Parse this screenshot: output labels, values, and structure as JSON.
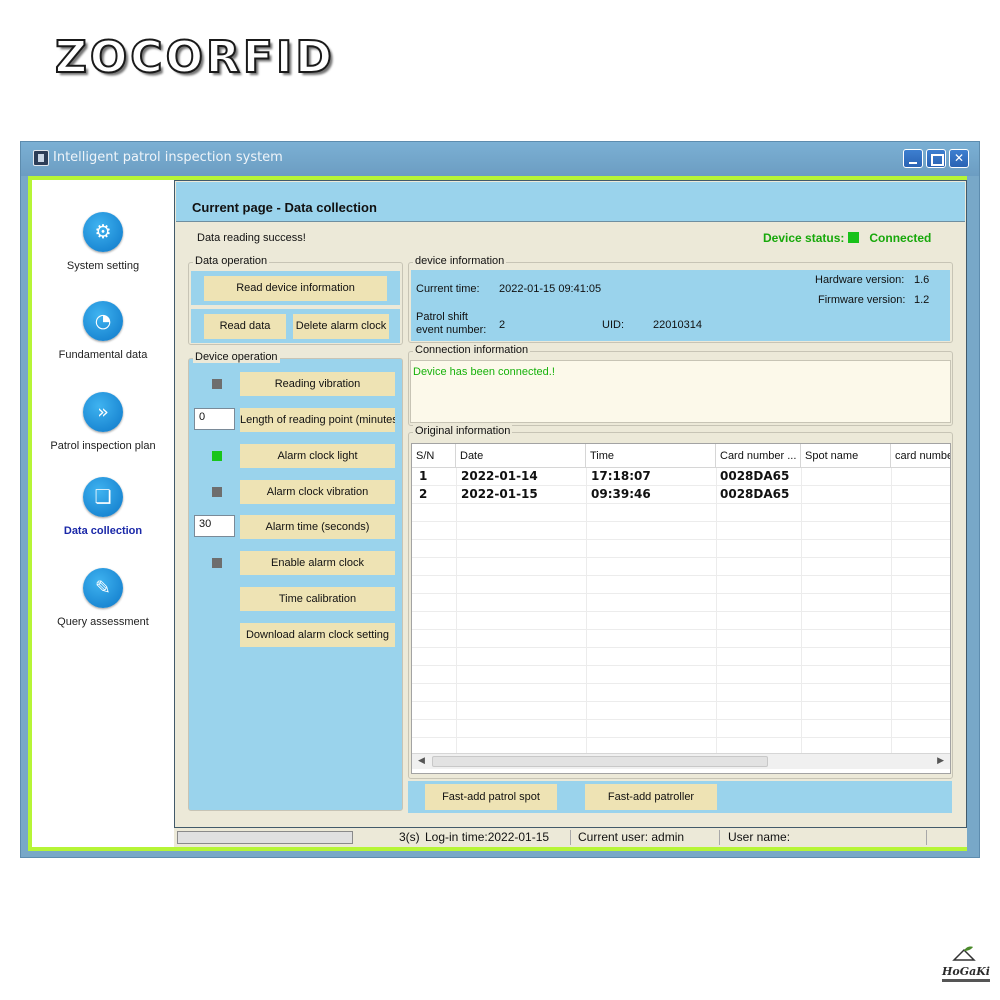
{
  "brand": {
    "logo_text": "ZOCORFID"
  },
  "window": {
    "title": "Intelligent patrol inspection system"
  },
  "sidebar": {
    "items": [
      {
        "label": "System setting",
        "icon": "gear-icon",
        "active": false
      },
      {
        "label": "Fundamental data",
        "icon": "pie-chart-icon",
        "active": false
      },
      {
        "label": "Patrol inspection plan",
        "icon": "double-chevron-icon",
        "active": false
      },
      {
        "label": "Data collection",
        "icon": "chat-bubbles-icon",
        "active": true
      },
      {
        "label": "Query assessment",
        "icon": "edit-icon",
        "active": false
      }
    ]
  },
  "main": {
    "page_title": "Current page - Data collection",
    "status_message": "Data reading success!",
    "device_status_label": "Device status:",
    "device_status_value": "Connected"
  },
  "data_operation": {
    "legend": "Data operation",
    "read_device_info": "Read device information",
    "read_data": "Read data",
    "delete_alarm_clock": "Delete alarm clock"
  },
  "device_operation": {
    "legend": "Device operation",
    "reading_vibration": "Reading vibration",
    "reading_length_value": "0",
    "reading_length_label": "Length of reading point (minutes)",
    "alarm_clock_light": "Alarm clock light",
    "alarm_clock_vibration": "Alarm clock vibration",
    "alarm_time_value": "30",
    "alarm_time_label": "Alarm time (seconds)",
    "enable_alarm_clock": "Enable alarm clock",
    "time_calibration": "Time calibration",
    "download_alarm_setting": "Download alarm clock setting"
  },
  "device_info": {
    "legend": "device information",
    "current_time_label": "Current time:",
    "current_time_value": "2022-01-15 09:41:05",
    "hardware_label": "Hardware version:",
    "hardware_value": "1.6",
    "firmware_label": "Firmware version:",
    "firmware_value": "1.2",
    "shift_label_line1": "Patrol shift",
    "shift_label_line2": "event number:",
    "shift_value": "2",
    "uid_label": "UID:",
    "uid_value": "22010314"
  },
  "connection_info": {
    "legend": "Connection information",
    "message": "Device has been connected.!"
  },
  "original_info": {
    "legend": "Original information",
    "columns": [
      "S/N",
      "Date",
      "Time",
      "Card number ...",
      "Spot name",
      "card numbe"
    ],
    "rows": [
      {
        "sn": "1",
        "date": "2022-01-14",
        "time": "17:18:07",
        "card": "0028DA65"
      },
      {
        "sn": "2",
        "date": "2022-01-15",
        "time": "09:39:46",
        "card": "0028DA65"
      }
    ]
  },
  "bottom_buttons": {
    "fast_add_spot": "Fast-add patrol spot",
    "fast_add_patroller": "Fast-add patroller"
  },
  "statusbar": {
    "seconds": "3(s)",
    "login_time": "Log-in time:2022-01-15",
    "current_user": "Current user: admin",
    "user_name": "User name:"
  },
  "watermark": {
    "text": "HoGaKi"
  },
  "colors": {
    "panel_blue": "#9ad3ec",
    "button_beige": "#eee3b4",
    "status_green": "#17a80a",
    "active_nav": "#1a28a8"
  }
}
